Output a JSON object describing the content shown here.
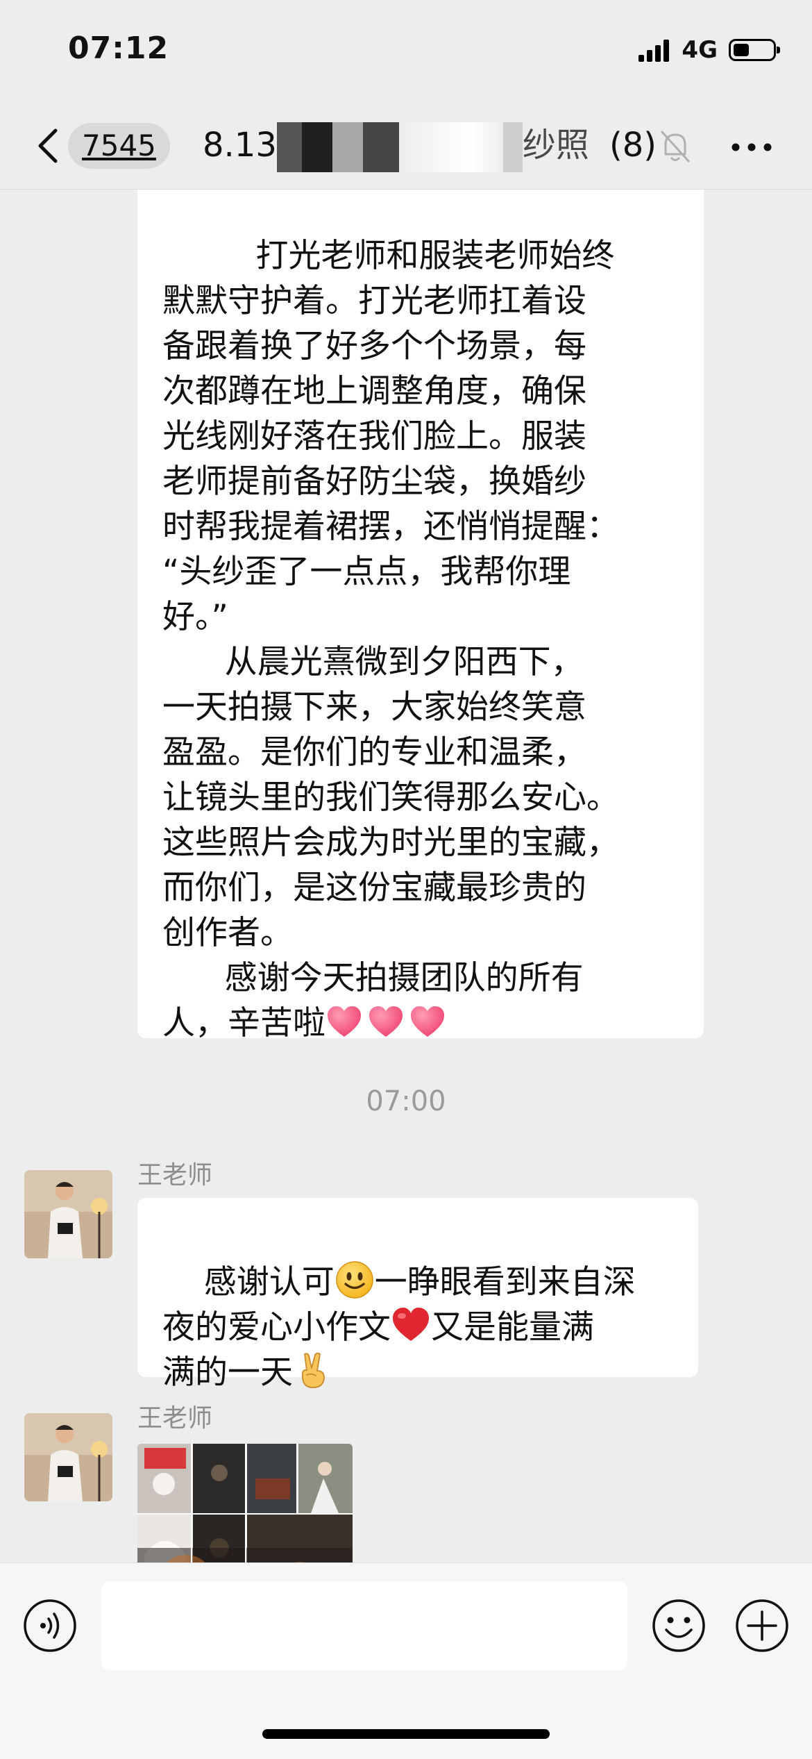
{
  "status_bar": {
    "time": "07:12",
    "network": "4G",
    "battery_level": 0.4
  },
  "nav": {
    "unread_count": "7545",
    "title_prefix": "8.13",
    "title_suffix": "纱照",
    "member_count": "(8)",
    "icons": [
      "back-icon",
      "mute-bell-icon",
      "more-icon"
    ]
  },
  "messages": [
    {
      "type": "text",
      "side": "left",
      "text": "     打光老师和服装老师始终\n默默守护着。打光老师扛着设\n备跟着换了好多个个场景，每\n次都蹲在地上调整角度，确保\n光线刚好落在我们脸上。服装\n老师提前备好防尘袋，换婚纱\n时帮我提着裙摆，还悄悄提醒：\n“头纱歪了一点点，我帮你理\n好。”\n      从晨光熹微到夕阳西下，\n一天拍摄下来，大家始终笑意\n盈盈。是你们的专业和温柔，\n让镜头里的我们笑得那么安心。\n这些照片会成为时光里的宝藏，\n而你们，是这份宝藏最珍贵的\n创作者。\n      感谢今天拍摄团队的所有\n人，辛苦啦",
      "trailing_emoji": [
        "pink-heart",
        "pink-heart",
        "pink-heart"
      ]
    },
    {
      "type": "timestamp",
      "text": "07:00"
    },
    {
      "type": "text",
      "sender": "王老师",
      "parts": [
        "感谢认可",
        "一睁眼看到来自深\n夜的爱心小作文",
        "又是能量满\n满的一天"
      ],
      "emoji": [
        "smiley-emoji",
        "red-heart-emoji",
        "victory-hand-emoji"
      ]
    },
    {
      "type": "image-album",
      "sender": "王老师",
      "photo_count": 6
    }
  ],
  "input_bar": {
    "placeholder": "",
    "icons": [
      "voice-icon",
      "emoji-icon",
      "plus-icon"
    ]
  },
  "colors": {
    "background": "#ededed",
    "bubble": "#ffffff",
    "timestamp": "#9a9a9a",
    "sender": "#8d8d8d",
    "heart_pink": "#f0426f",
    "heart_red": "#e0262f"
  }
}
